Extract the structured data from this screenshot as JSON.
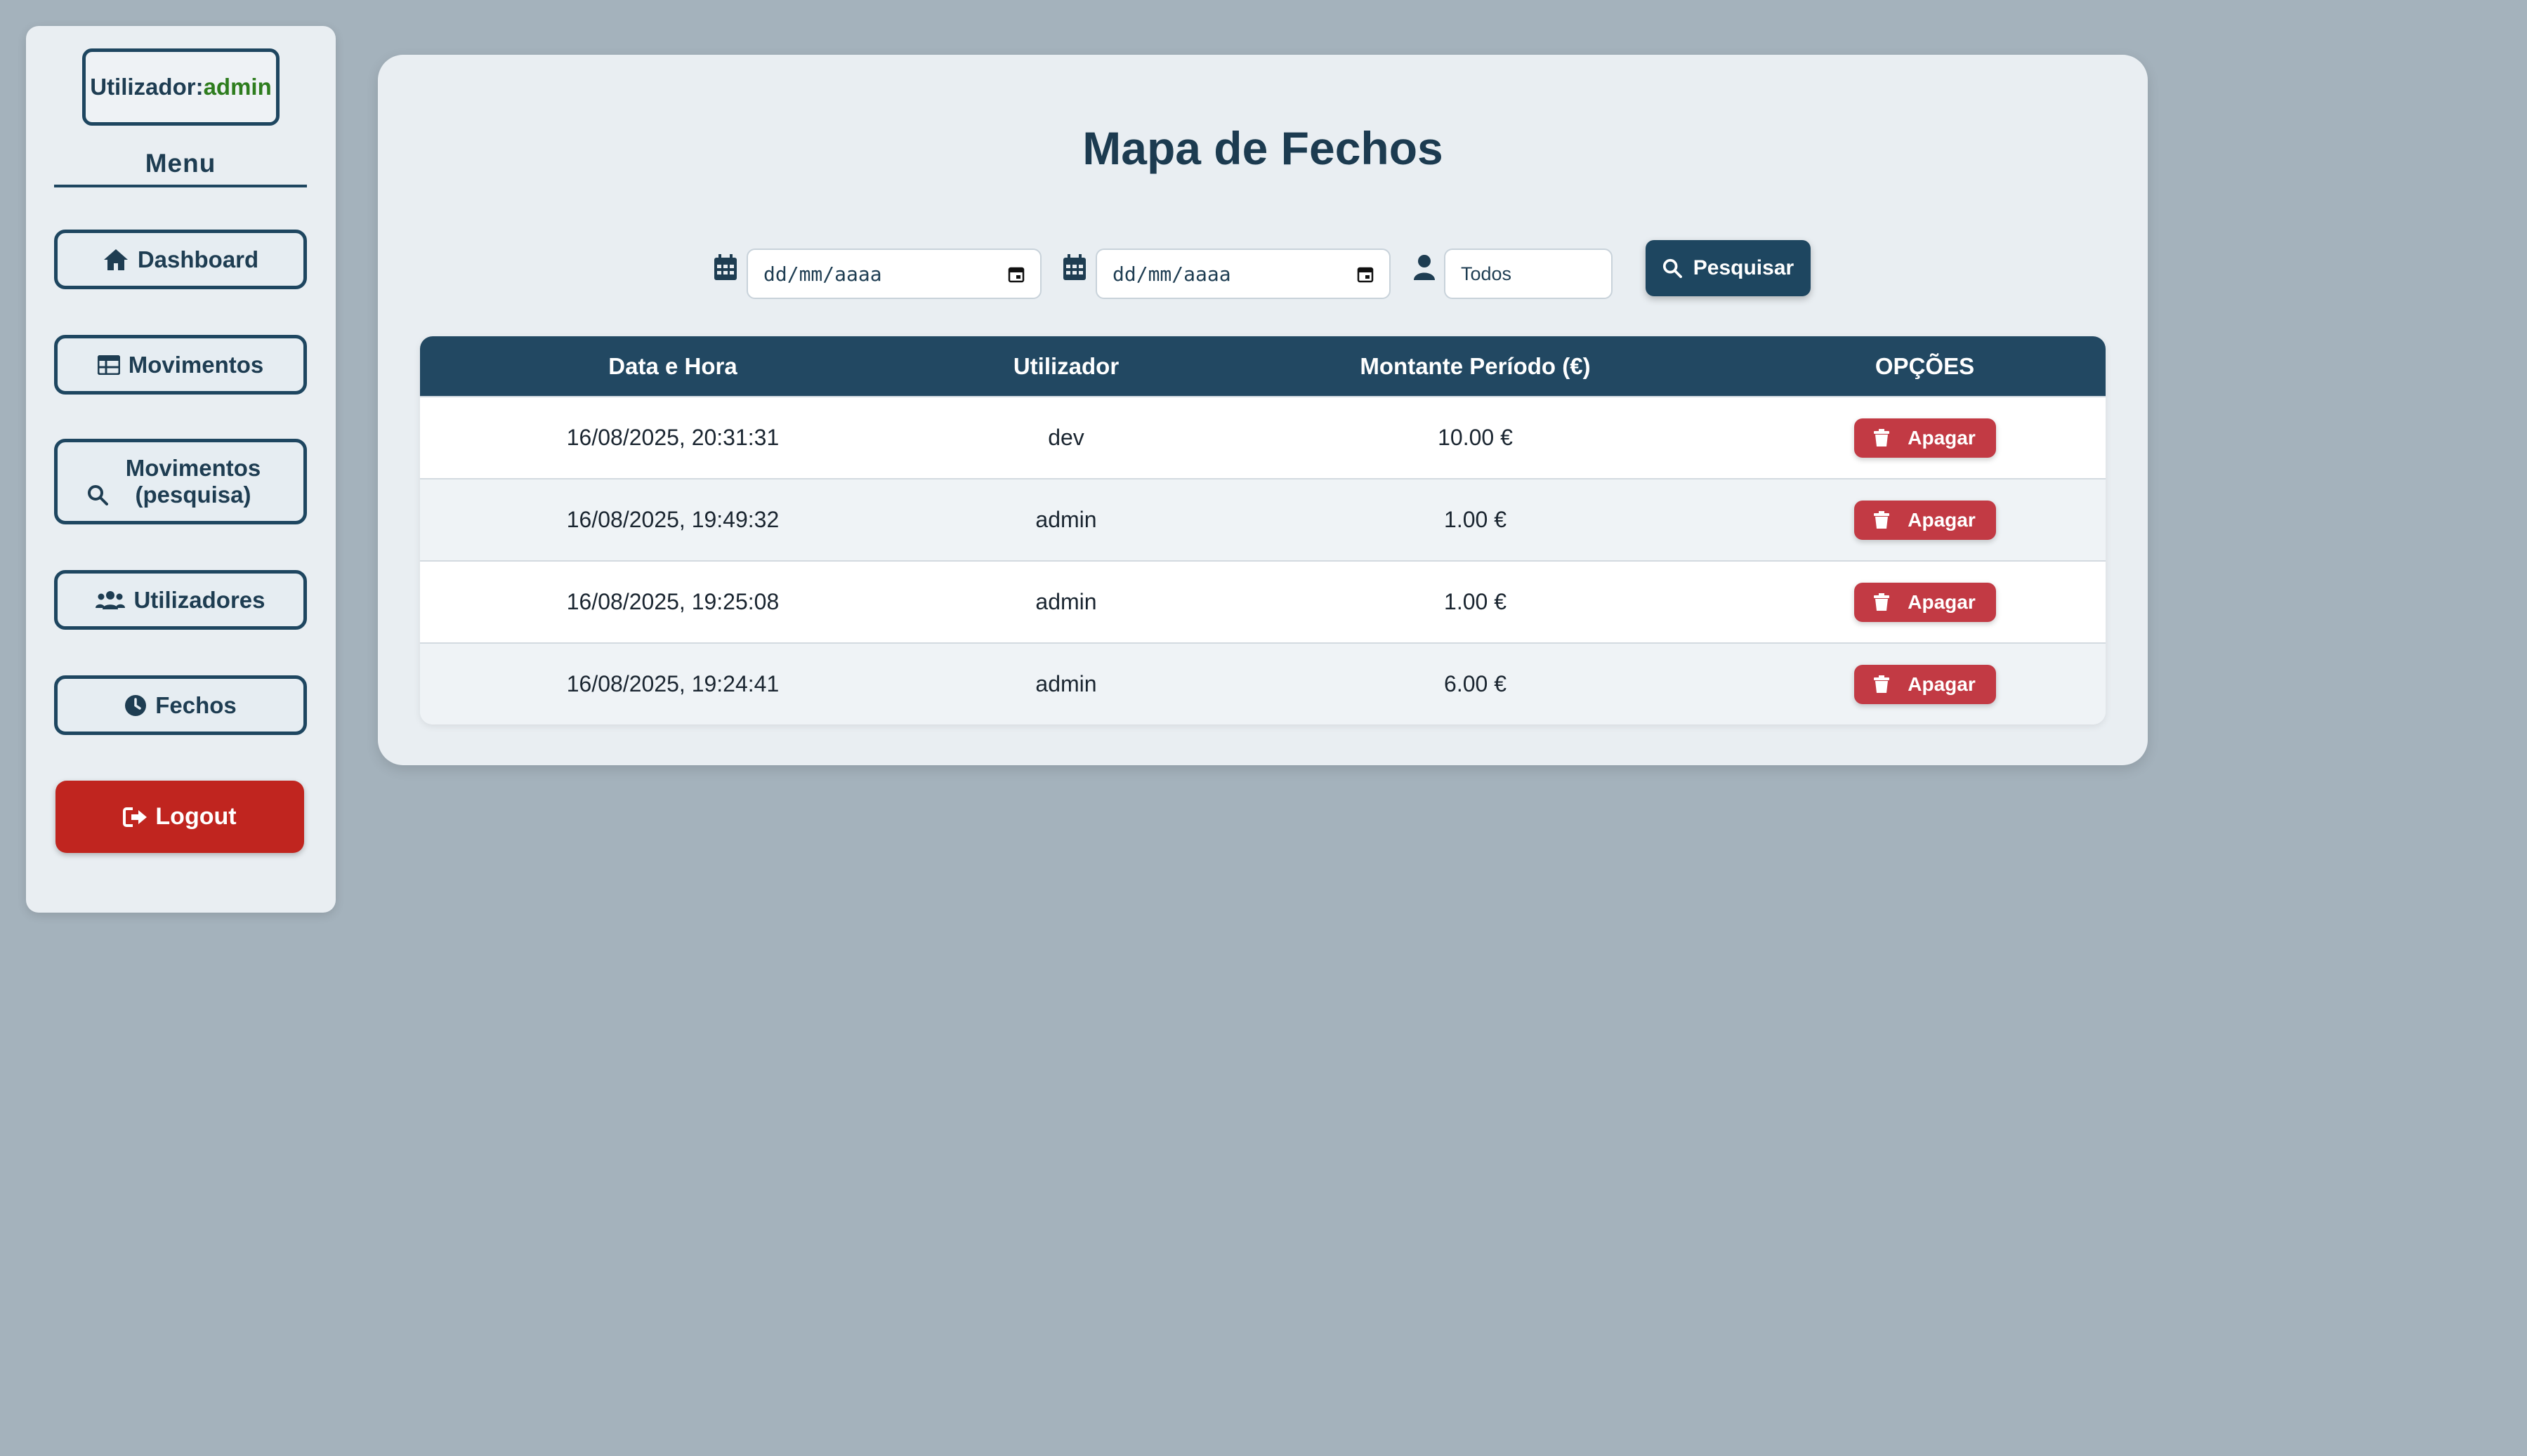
{
  "sidebar": {
    "user_label": "Utilizador:",
    "user_name": "admin",
    "menu_title": "Menu",
    "items": [
      {
        "label": "Dashboard",
        "icon": "home-icon"
      },
      {
        "label": "Movimentos",
        "icon": "table-icon"
      },
      {
        "label": "Movimentos (pesquisa)",
        "icon": "search-icon"
      },
      {
        "label": "Utilizadores",
        "icon": "users-icon"
      },
      {
        "label": "Fechos",
        "icon": "clock-icon"
      }
    ],
    "logout_label": "Logout"
  },
  "main": {
    "title": "Mapa de Fechos",
    "filters": {
      "date_from_placeholder": "dd/mm/aaaa",
      "date_to_placeholder": "dd/mm/aaaa",
      "user_value": "Todos",
      "search_label": "Pesquisar"
    },
    "table": {
      "headers": [
        "Data e Hora",
        "Utilizador",
        "Montante Período (€)",
        "OPÇÕES"
      ],
      "rows": [
        {
          "datetime": "16/08/2025, 20:31:31",
          "user": "dev",
          "amount": "10.00 €",
          "action": "Apagar"
        },
        {
          "datetime": "16/08/2025, 19:49:32",
          "user": "admin",
          "amount": "1.00 €",
          "action": "Apagar"
        },
        {
          "datetime": "16/08/2025, 19:25:08",
          "user": "admin",
          "amount": "1.00 €",
          "action": "Apagar"
        },
        {
          "datetime": "16/08/2025, 19:24:41",
          "user": "admin",
          "amount": "6.00 €",
          "action": "Apagar"
        }
      ]
    }
  },
  "colors": {
    "background": "#a4b2bc",
    "primary": "#1e4660",
    "danger": "#c0251f",
    "username": "#2e7d1e"
  }
}
